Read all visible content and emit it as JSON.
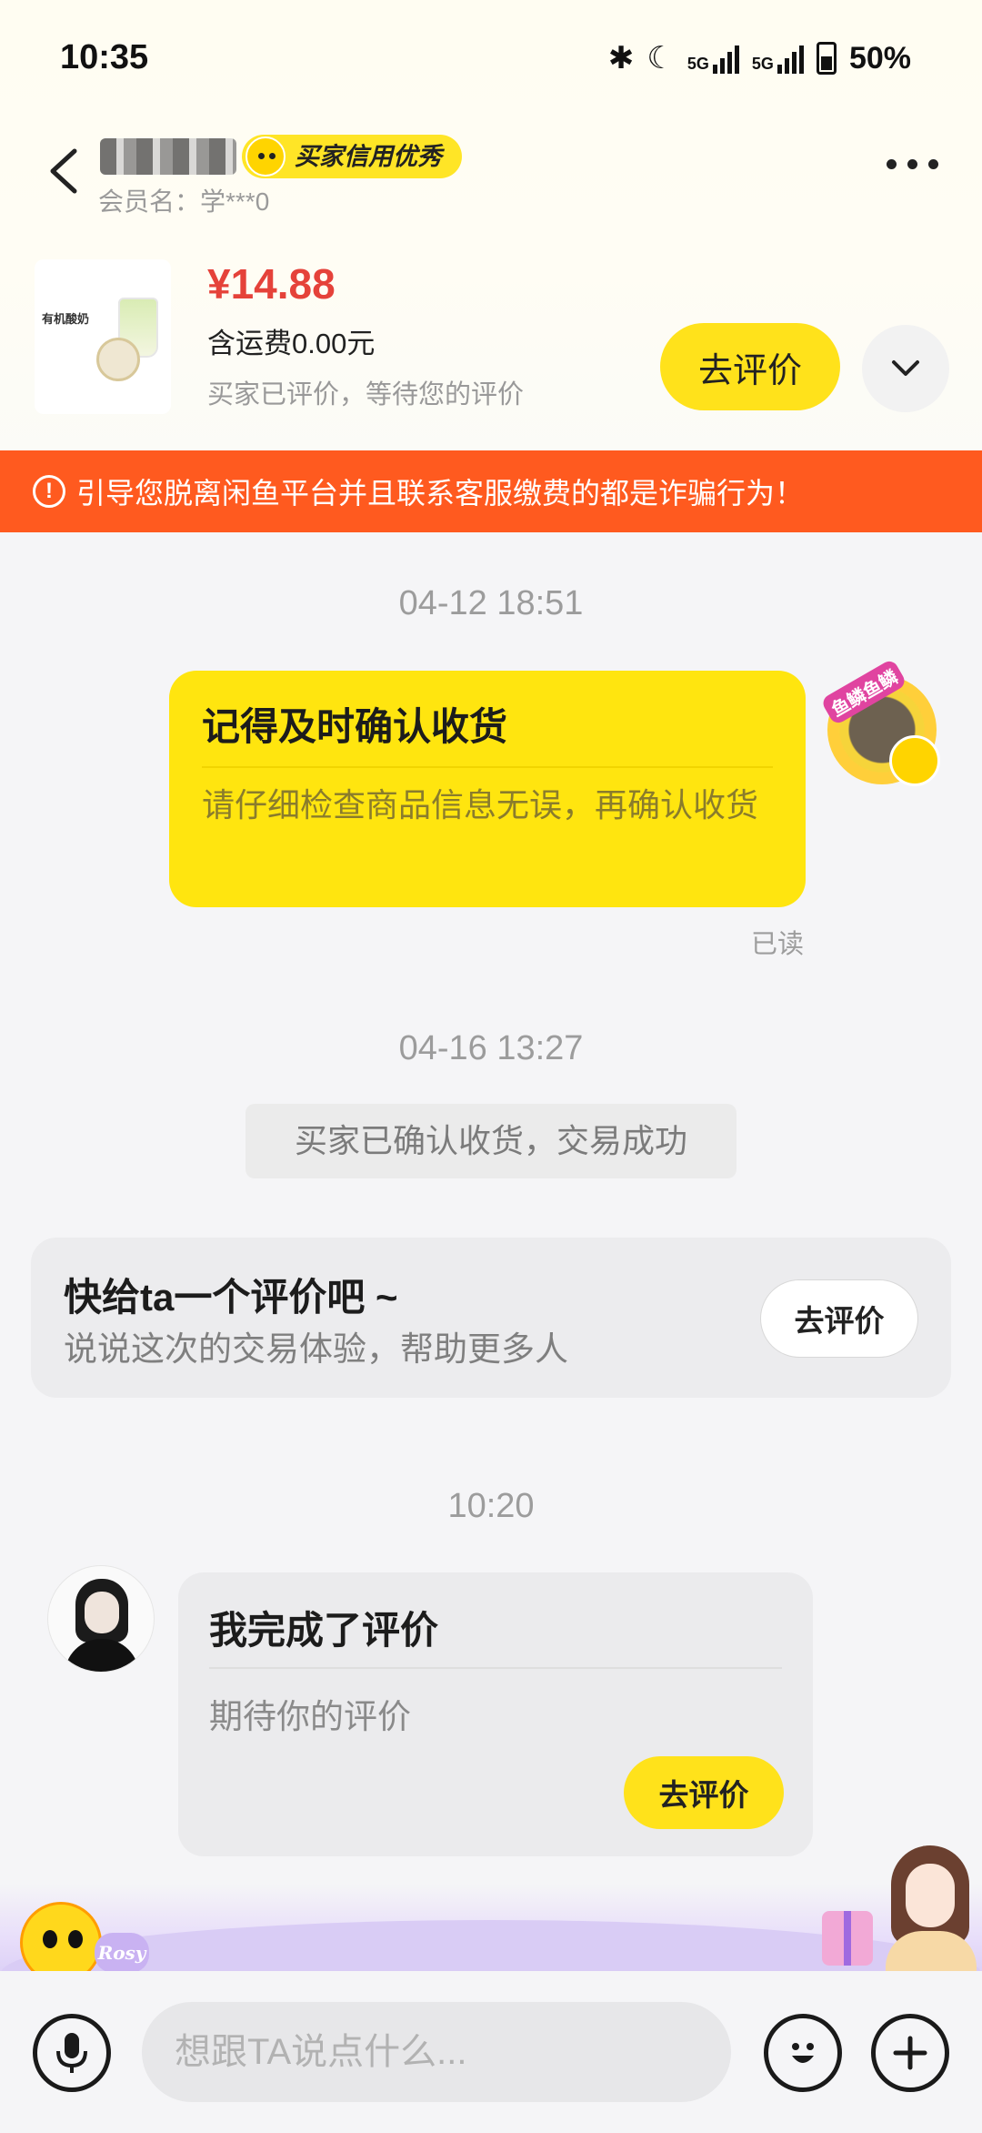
{
  "status_bar": {
    "time": "10:35",
    "network1": "5G",
    "network2": "5G",
    "battery": "50%"
  },
  "header": {
    "credit_badge": "买家信用优秀",
    "member": "会员名：学***0"
  },
  "product": {
    "price": "¥14.88",
    "shipping": "含运费0.00元",
    "status": "买家已评价，等待您的评价",
    "review_button": "去评价",
    "thumb_text": "有机酸奶"
  },
  "warning": {
    "text": "引导您脱离闲鱼平台并且联系客服缴费的都是诈骗行为！"
  },
  "messages": {
    "time1": "04-12 18:51",
    "reminder_title": "记得及时确认收货",
    "reminder_body": "请仔细检查商品信息无误，再确认收货",
    "avatar_tag": "鱼鳞鱼鳞",
    "read_label": "已读",
    "time2": "04-16 13:27",
    "system_notice": "买家已确认收货，交易成功",
    "review_prompt_title": "快给ta一个评价吧 ~",
    "review_prompt_sub": "说说这次的交易体验，帮助更多人",
    "review_prompt_button": "去评价",
    "time3": "10:20",
    "done_title": "我完成了评价",
    "done_body": "期待你的评价",
    "done_button": "去评价"
  },
  "decor": {
    "heart_tag": "Rosy"
  },
  "composer": {
    "placeholder": "想跟TA说点什么..."
  },
  "colors": {
    "accent_yellow": "#ffe21b",
    "warning_orange": "#ff5a1f",
    "price_red": "#e5423a"
  }
}
